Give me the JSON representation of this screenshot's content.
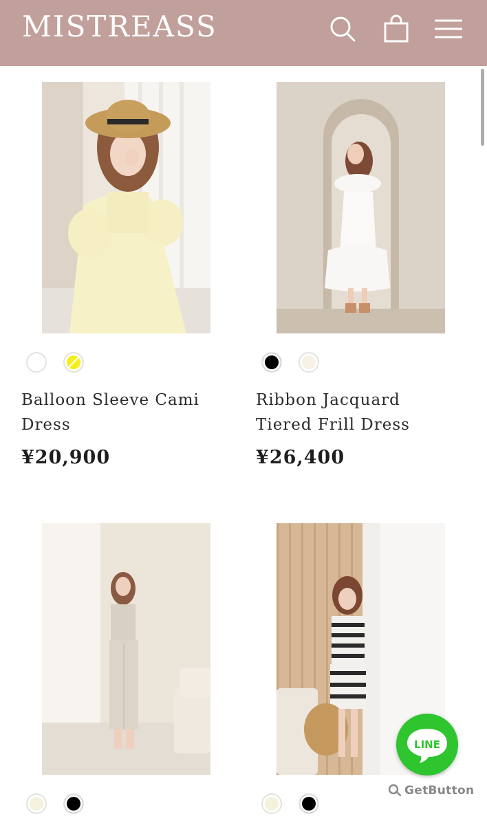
{
  "header": {
    "logo": "MISTREASS",
    "bg_color": "#c19f9a",
    "icons": [
      "search-icon",
      "shopping-bag-icon",
      "hamburger-menu-icon"
    ]
  },
  "products": [
    {
      "name_line1": "Balloon Sleeve Cami",
      "name_line2": "Dress",
      "price": "¥20,900",
      "swatches": [
        {
          "color": "#ffffff",
          "label": "white"
        },
        {
          "color": "#f5ee1e",
          "label": "yellow"
        }
      ]
    },
    {
      "name_line1": "Ribbon Jacquard",
      "name_line2": "Tiered Frill Dress",
      "price": "¥26,400",
      "swatches": [
        {
          "color": "#000000",
          "label": "black"
        },
        {
          "color": "#f8f1e6",
          "label": "ivory"
        }
      ]
    },
    {
      "swatches": [
        {
          "color": "#f4f2dc",
          "label": "cream"
        },
        {
          "color": "#000000",
          "label": "black"
        }
      ]
    },
    {
      "swatches": [
        {
          "color": "#f4f2dc",
          "label": "cream"
        },
        {
          "color": "#000000",
          "label": "black"
        }
      ]
    }
  ],
  "widget": {
    "line_label": "LINE",
    "line_color": "#2ec52e",
    "getbutton_label": "GetButton"
  }
}
